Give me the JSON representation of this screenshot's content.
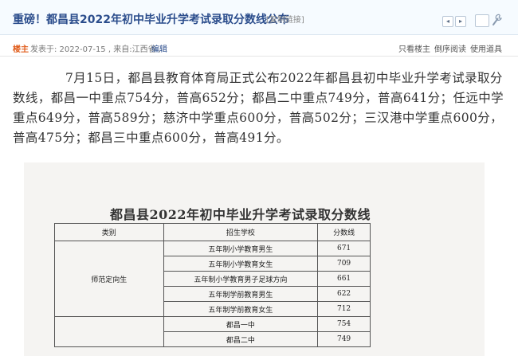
{
  "header": {
    "title": "重磅！都昌县2022年初中毕业升学考试录取分数线公布",
    "copy_link": "[复制链接]",
    "prev": "◂",
    "next": "▸",
    "icons": [
      "prev-icon",
      "next-icon",
      "favorite-box",
      "wrench-icon"
    ]
  },
  "meta": {
    "author_badge": "楼主",
    "post_info": "发表于: 2022-07-15 , 来自:江西省 ,",
    "edit": "编辑",
    "only_op": "只看楼主",
    "reverse": "倒序阅读",
    "tools": "使用道具"
  },
  "article": {
    "body": "7月15日，都昌县教育体育局正式公布2022年都昌县初中毕业升学考试录取分数线，都昌一中重点754分，普高652分；都昌二中重点749分，普高641分；任远中学重点649分，普高589分；慈济中学重点600分，普高502分；三汉港中学重点600分，普高475分；都昌三中重点600分，普高491分。"
  },
  "document": {
    "title": "都昌县2022年初中毕业升学考试录取分数线",
    "headers": [
      "类别",
      "招生学校",
      "分数线"
    ],
    "normal_school": {
      "category": "师范定向生",
      "rows": [
        {
          "school": "五年制小学教育男生",
          "score": "671"
        },
        {
          "school": "五年制小学教育女生",
          "score": "709"
        },
        {
          "school": "五年制小学教育男子足球方向",
          "score": "661"
        },
        {
          "school": "五年制学前教育男生",
          "score": "622"
        },
        {
          "school": "五年制学前教育女生",
          "score": "712"
        }
      ]
    },
    "key_schools": {
      "rows": [
        {
          "school": "都昌一中",
          "score": "754"
        },
        {
          "school": "都昌二中",
          "score": "749"
        }
      ]
    }
  },
  "colors": {
    "title": "#2b4d8c",
    "header_bg": "#f6fbff",
    "author_badge": "#e05c1a",
    "document_bg": "#f5f4f2"
  }
}
